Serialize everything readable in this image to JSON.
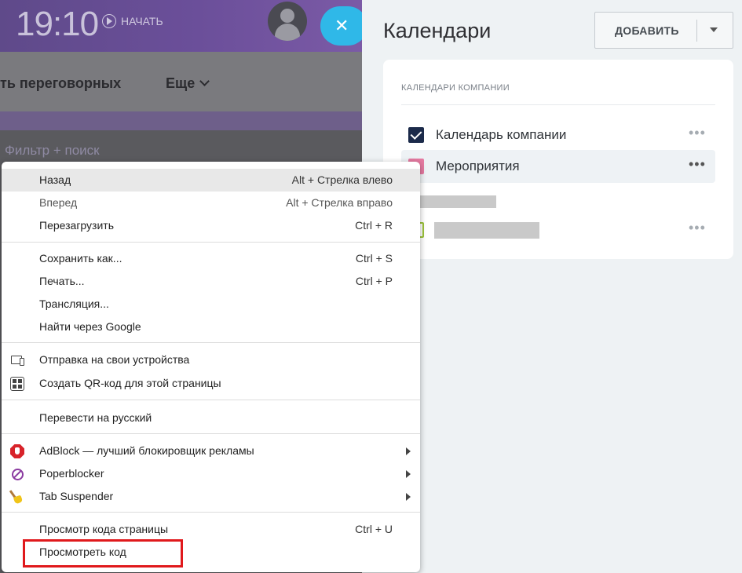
{
  "app": {
    "time": "19:10",
    "start_label": "НАЧАТЬ",
    "close_glyph": "✕",
    "nav_partial": "ть переговорных",
    "nav_more": "Еще",
    "filter_placeholder": "Фильтр + поиск"
  },
  "calendars_panel": {
    "title": "Календари",
    "add_button": "ДОБАВИТЬ",
    "section_title": "КАЛЕНДАРИ КОМПАНИИ",
    "items": [
      {
        "name": "Календарь компании",
        "color": "#1b2a4a",
        "checked": true,
        "more": "•••"
      },
      {
        "name": "Мероприятия",
        "color": "#e57aa1",
        "checked": false,
        "more": "•••"
      },
      {
        "name": "",
        "color": "#9bc33a",
        "checked": false,
        "more": "•••"
      }
    ]
  },
  "context_menu": {
    "groups": [
      [
        {
          "label": "Назад",
          "shortcut": "Alt + Стрелка влево",
          "highlighted": true
        },
        {
          "label": "Вперед",
          "shortcut": "Alt + Стрелка вправо",
          "disabled": true
        },
        {
          "label": "Перезагрузить",
          "shortcut": "Ctrl + R"
        }
      ],
      [
        {
          "label": "Сохранить как...",
          "shortcut": "Ctrl + S"
        },
        {
          "label": "Печать...",
          "shortcut": "Ctrl + P"
        },
        {
          "label": "Трансляция..."
        },
        {
          "label": "Найти через Google"
        }
      ],
      [
        {
          "label": "Отправка на свои устройства",
          "icon": "devices-icon"
        },
        {
          "label": "Создать QR-код для этой страницы",
          "icon": "qr-code-icon"
        }
      ],
      [
        {
          "label": "Перевести на русский"
        }
      ],
      [
        {
          "label": "AdBlock — лучший блокировщик рекламы",
          "icon": "adblock-icon",
          "submenu": true
        },
        {
          "label": "Poperblocker",
          "icon": "poperblocker-icon",
          "submenu": true
        },
        {
          "label": "Tab Suspender",
          "icon": "broom-icon",
          "submenu": true
        }
      ],
      [
        {
          "label": "Просмотр кода страницы",
          "shortcut": "Ctrl + U"
        },
        {
          "label": "Просмотреть код",
          "highlighted_box": true
        }
      ]
    ]
  },
  "colors": {
    "accent_close": "#2fb8e8",
    "highlight_box": "#e0191c"
  }
}
